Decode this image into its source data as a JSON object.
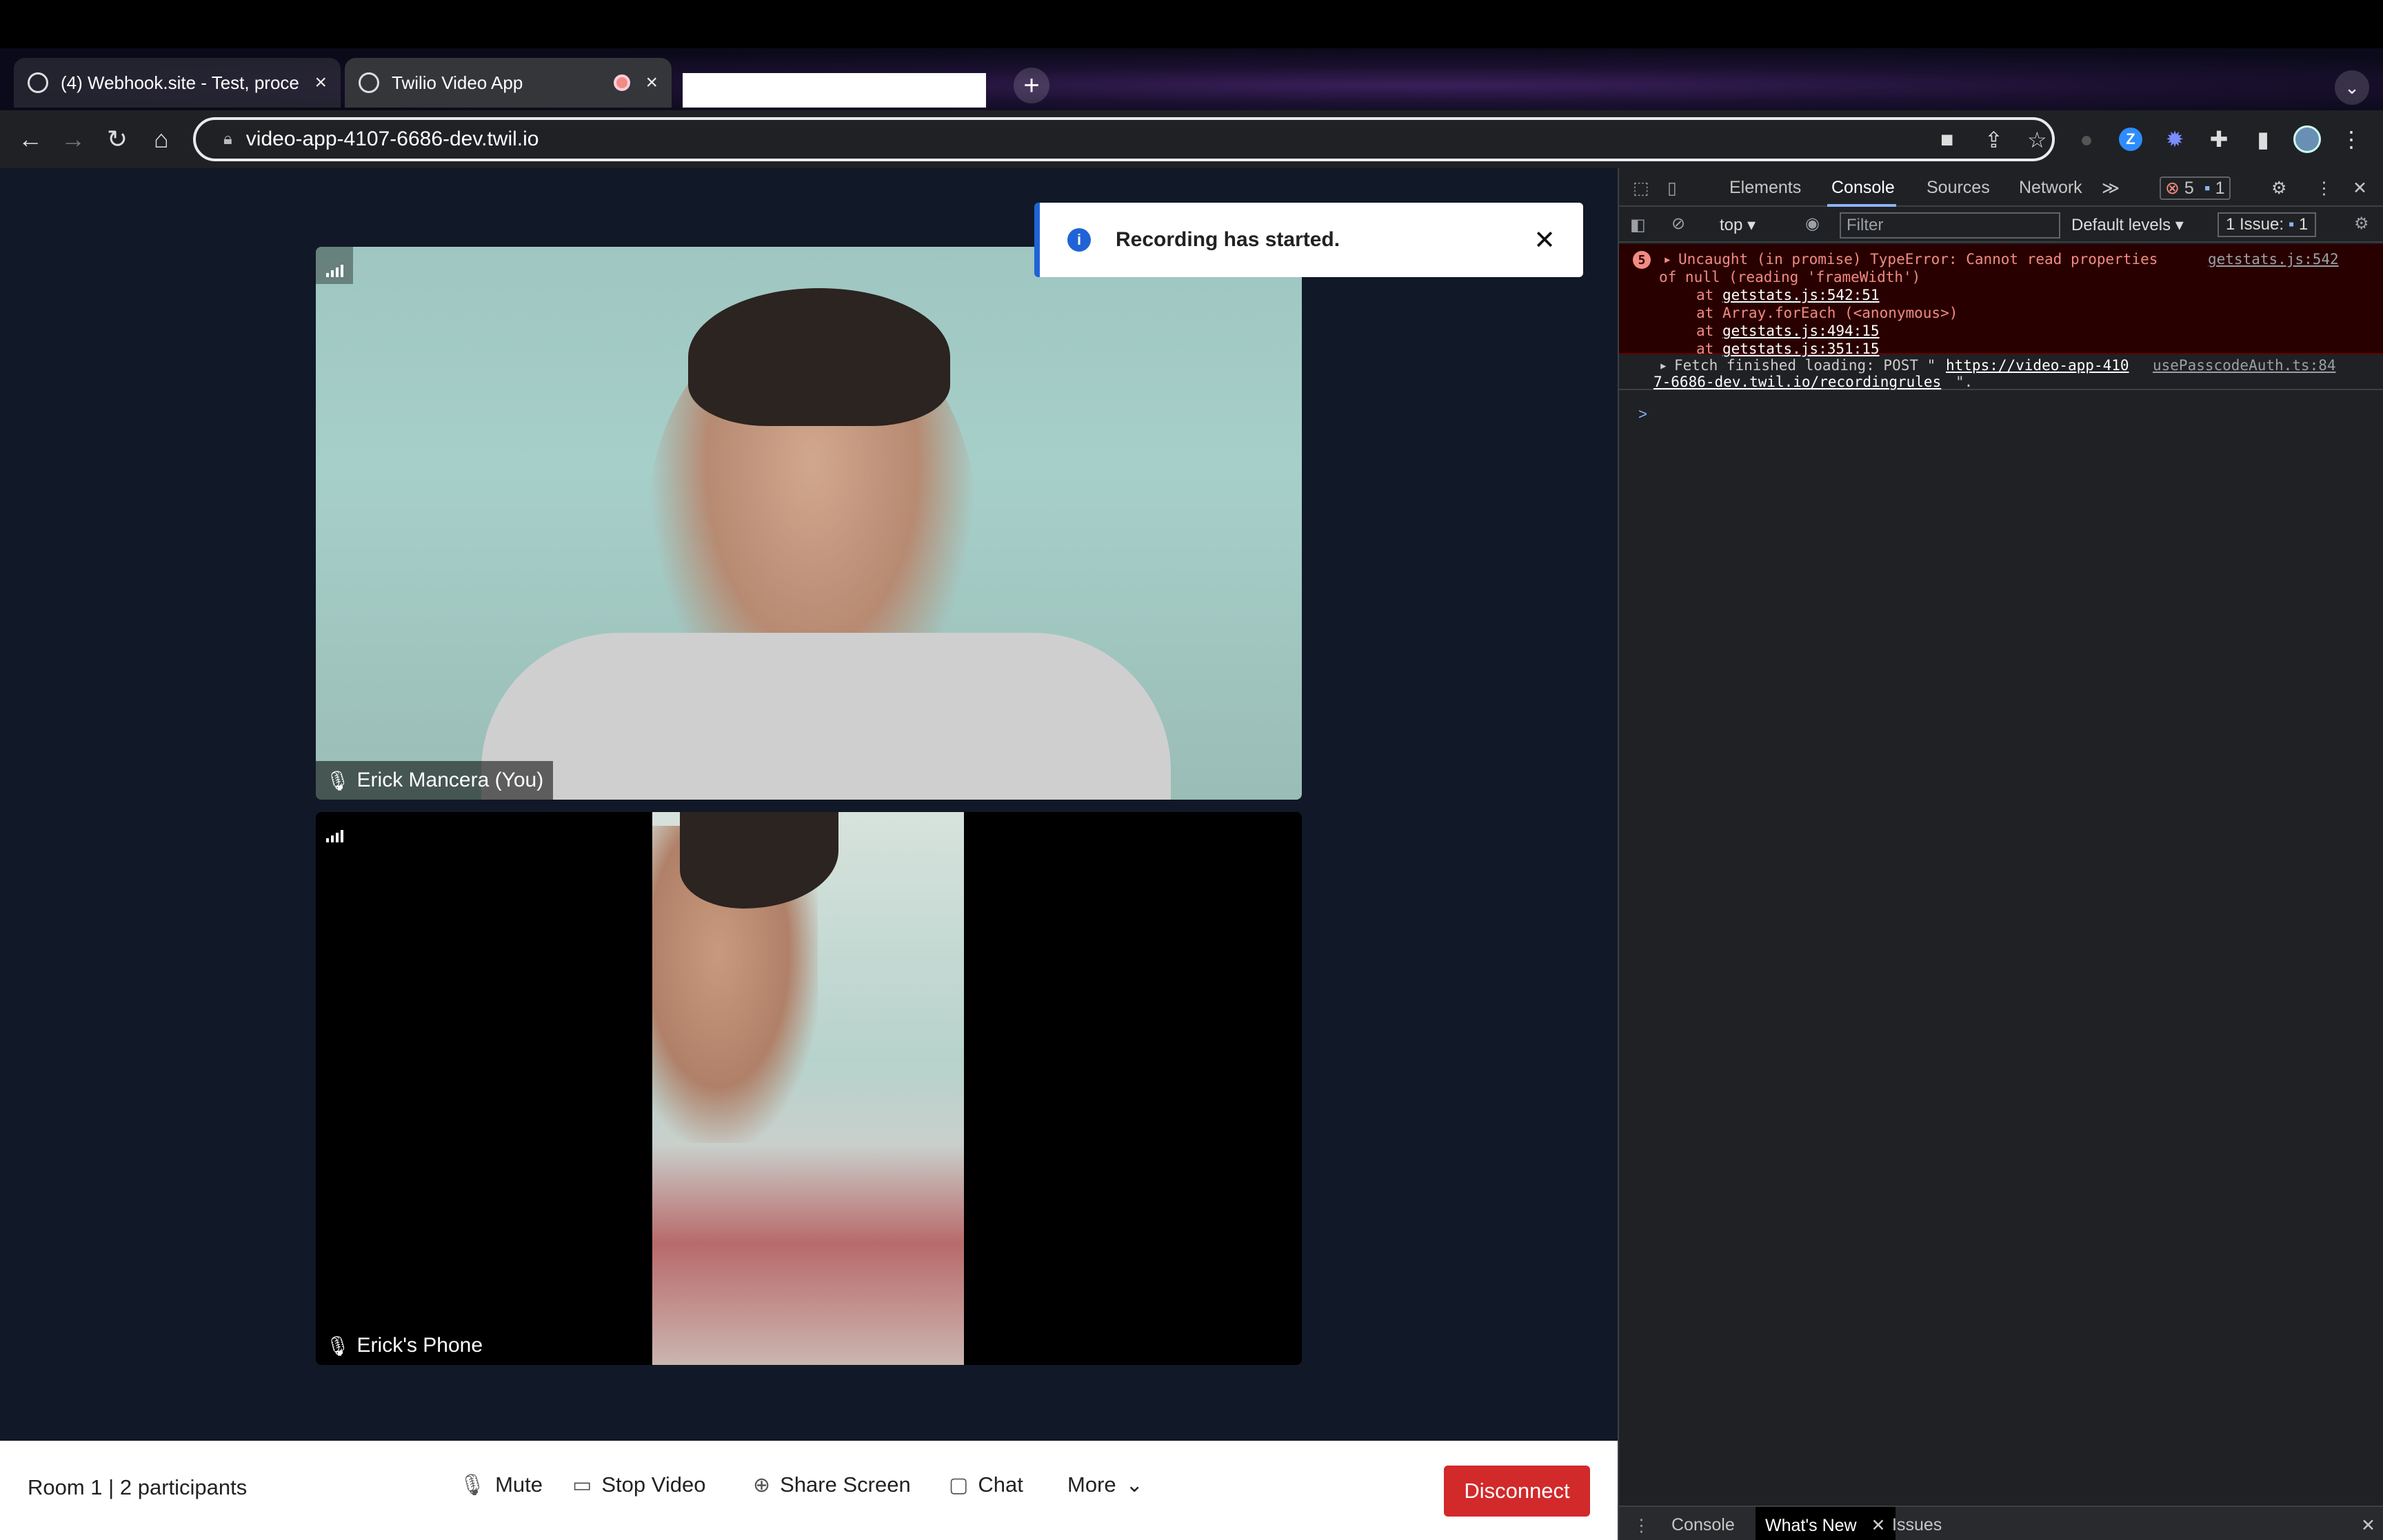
{
  "browser": {
    "tabs": [
      {
        "title": "(4) Webhook.site - Test, proce",
        "close": "×"
      },
      {
        "title": "Twilio Video App",
        "close": "×"
      }
    ],
    "new_tab": "+",
    "url": "video-app-4107-6686-dev.twil.io"
  },
  "toast": {
    "message": "Recording has started.",
    "icon": "i",
    "close": "✕"
  },
  "video": {
    "local_name": "Erick Mancera (You)",
    "remote_name": "Erick's Phone"
  },
  "bottombar": {
    "room": "Room 1",
    "separator": "|",
    "participants": "2 participants",
    "mute": "Mute",
    "stop_video": "Stop Video",
    "share_screen": "Share Screen",
    "chat": "Chat",
    "more": "More",
    "disconnect": "Disconnect"
  },
  "devtools": {
    "tabs": [
      "Elements",
      "Console",
      "Sources",
      "Network"
    ],
    "more_tabs": "≫",
    "error_count": "5",
    "message_count": "1",
    "context": "top",
    "filter_placeholder": "Filter",
    "levels": "Default levels",
    "issues_label": "1 Issue:",
    "issues_count": "1",
    "error": {
      "count": "5",
      "line1": "Uncaught (in promise) TypeError: Cannot read properties",
      "line2": "of null (reading 'frameWidth')",
      "at1": "getstats.js:542:51",
      "at2": "Array.forEach (<anonymous>)",
      "at3": "getstats.js:494:15",
      "at4": "getstats.js:351:15",
      "at_label": "at",
      "source": "getstats.js:542"
    },
    "log": {
      "prefix": "Fetch finished loading: POST \"",
      "url1": "https://video-app-410",
      "url2": "7-6686-dev.twil.io/recordingrules",
      "suffix": "\".",
      "source": "usePasscodeAuth.ts:84"
    },
    "prompt": ">",
    "drawer": {
      "console": "Console",
      "whats_new": "What's New",
      "issues": "Issues"
    }
  }
}
